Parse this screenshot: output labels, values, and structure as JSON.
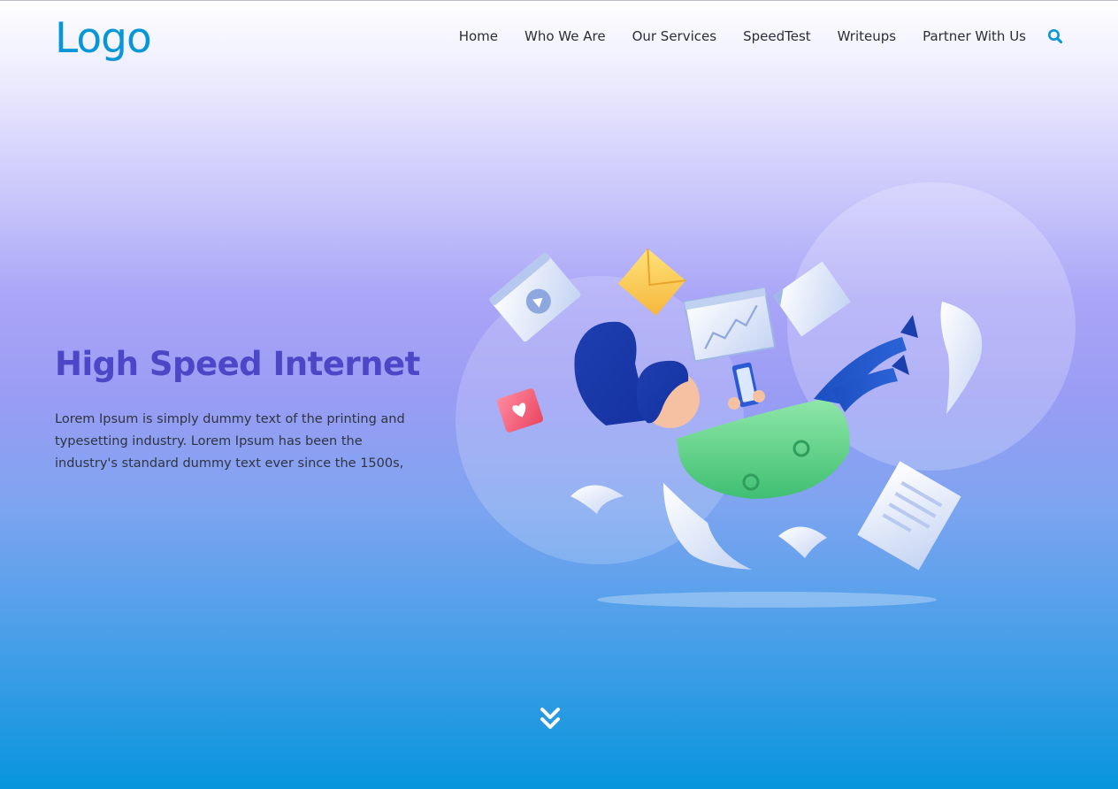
{
  "header": {
    "logo": "Logo",
    "nav": [
      {
        "label": "Home"
      },
      {
        "label": "Who We Are"
      },
      {
        "label": "Our Services"
      },
      {
        "label": "SpeedTest"
      },
      {
        "label": "Writeups"
      },
      {
        "label": "Partner With Us"
      }
    ],
    "search_icon": "search-icon"
  },
  "hero": {
    "title": "High Speed Internet",
    "text": "Lorem Ipsum is simply dummy text of the printing and typesetting industry. Lorem Ipsum has been the industry's standard dummy text ever since the 1500s,"
  },
  "scroll_icon": "double-chevron-down-icon",
  "colors": {
    "brand": "#0796d8",
    "title": "#4b47c6",
    "text": "#2f3440"
  }
}
